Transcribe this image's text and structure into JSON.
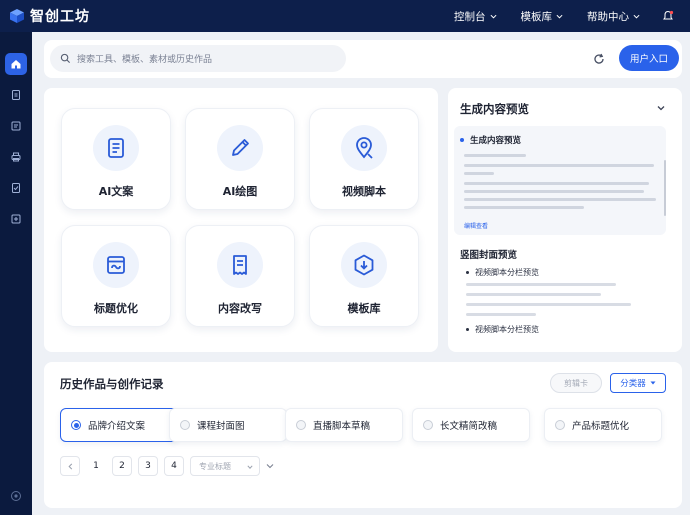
{
  "app": {
    "name": "智创工坊"
  },
  "topnav": {
    "items": [
      {
        "label": "控制台"
      },
      {
        "label": "模板库"
      },
      {
        "label": "帮助中心"
      }
    ]
  },
  "search": {
    "placeholder": "搜索工具、模板、素材或历史作品"
  },
  "header": {
    "user_button": "用户入口"
  },
  "tools": [
    {
      "label": "AI文案",
      "icon": "document-icon"
    },
    {
      "label": "AI绘图",
      "icon": "pen-icon"
    },
    {
      "label": "视频脚本",
      "icon": "location-pin-icon"
    },
    {
      "label": "标题优化",
      "icon": "window-link-icon"
    },
    {
      "label": "内容改写",
      "icon": "receipt-icon"
    },
    {
      "label": "模板库",
      "icon": "hexagon-download-icon"
    }
  ],
  "preview": {
    "title": "生成内容预览",
    "card_heading": "生成内容预览",
    "card_link": "编辑查看",
    "section2_title": "竖图封面预览",
    "bullets": [
      "视频脚本分栏预览",
      "视频脚本分栏预览"
    ]
  },
  "history": {
    "title": "历史作品与创作记录",
    "filter_button": "剪辑卡",
    "sort_button": "分类器",
    "chips": [
      {
        "label": "品牌介绍文案",
        "active": true
      },
      {
        "label": "课程封面图",
        "active": false
      },
      {
        "label": "直播脚本草稿",
        "active": false
      },
      {
        "label": "长文精简改稿",
        "active": false
      },
      {
        "label": "产品标题优化",
        "active": false
      }
    ],
    "pagination": {
      "pages": [
        "1",
        "2",
        "3",
        "4"
      ],
      "select_placeholder": "专业标题"
    }
  },
  "colors": {
    "accent": "#2a62ea",
    "topbar": "#0d1f4b",
    "sidebar": "#0b1a3e"
  }
}
